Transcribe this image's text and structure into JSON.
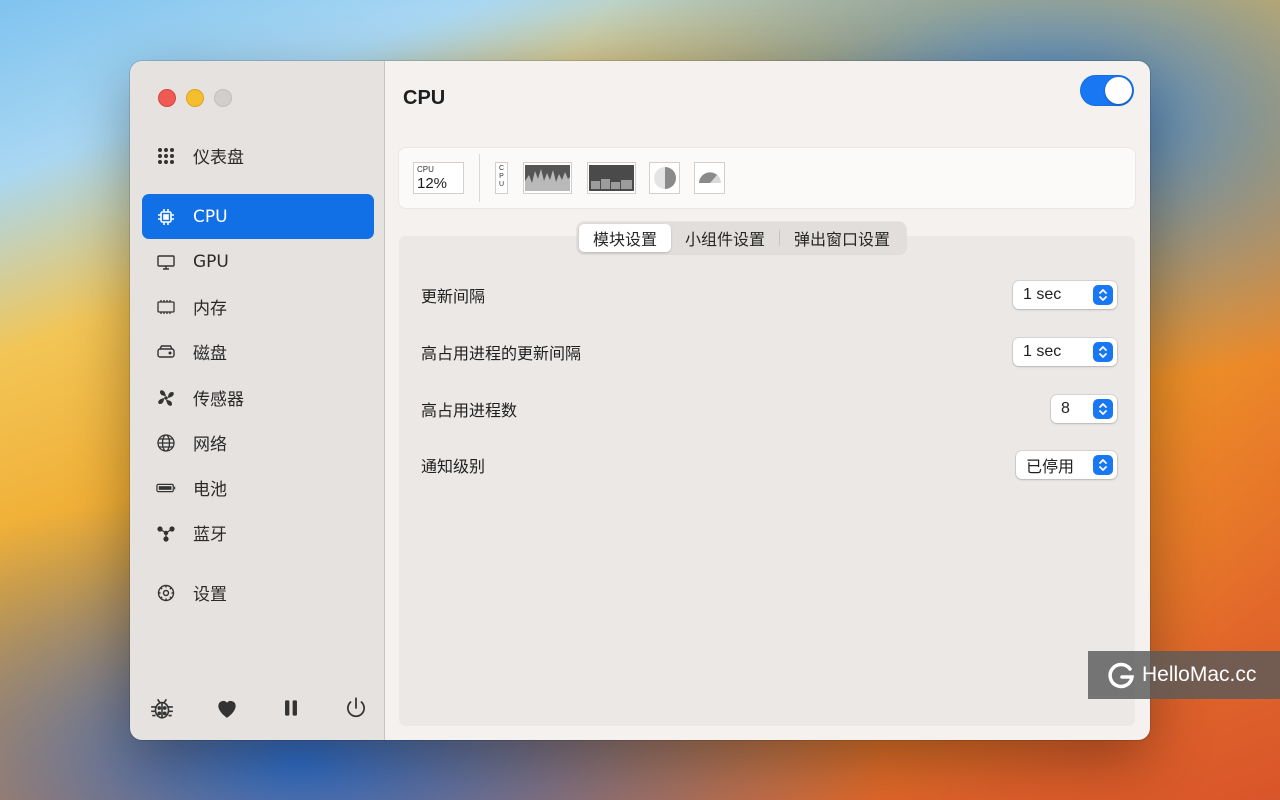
{
  "window": {
    "traffic_lights": [
      "close",
      "minimize",
      "zoom"
    ]
  },
  "sidebar": {
    "items": [
      {
        "label": "仪表盘",
        "icon": "dashboard-grid-icon"
      },
      {
        "label": "CPU",
        "icon": "cpu-chip-icon",
        "active": true
      },
      {
        "label": "GPU",
        "icon": "monitor-icon"
      },
      {
        "label": "内存",
        "icon": "memory-icon"
      },
      {
        "label": "磁盘",
        "icon": "disk-icon"
      },
      {
        "label": "传感器",
        "icon": "fan-icon"
      },
      {
        "label": "网络",
        "icon": "globe-icon"
      },
      {
        "label": "电池",
        "icon": "battery-icon"
      },
      {
        "label": "蓝牙",
        "icon": "bluetooth-network-icon"
      },
      {
        "label": "设置",
        "icon": "gear-icon"
      }
    ],
    "bottom_buttons": [
      "bug-icon",
      "heart-icon",
      "pause-icon",
      "power-icon"
    ]
  },
  "main": {
    "title": "CPU",
    "toggle_on": true,
    "widgets": {
      "mini_label": "CPU",
      "mini_value": "12%",
      "vertical_label": "CPU"
    },
    "tabs": [
      {
        "label": "模块设置",
        "active": true
      },
      {
        "label": "小组件设置"
      },
      {
        "label": "弹出窗口设置"
      }
    ],
    "settings": [
      {
        "label": "更新间隔",
        "value": "1 sec"
      },
      {
        "label": "高占用进程的更新间隔",
        "value": "1 sec"
      },
      {
        "label": "高占用进程数",
        "value": "8"
      },
      {
        "label": "通知级别",
        "value": "已停用"
      }
    ]
  },
  "watermark": {
    "text": "HelloMac.cc"
  },
  "colors": {
    "accent": "#1270e6",
    "toggle": "#1877f2"
  }
}
